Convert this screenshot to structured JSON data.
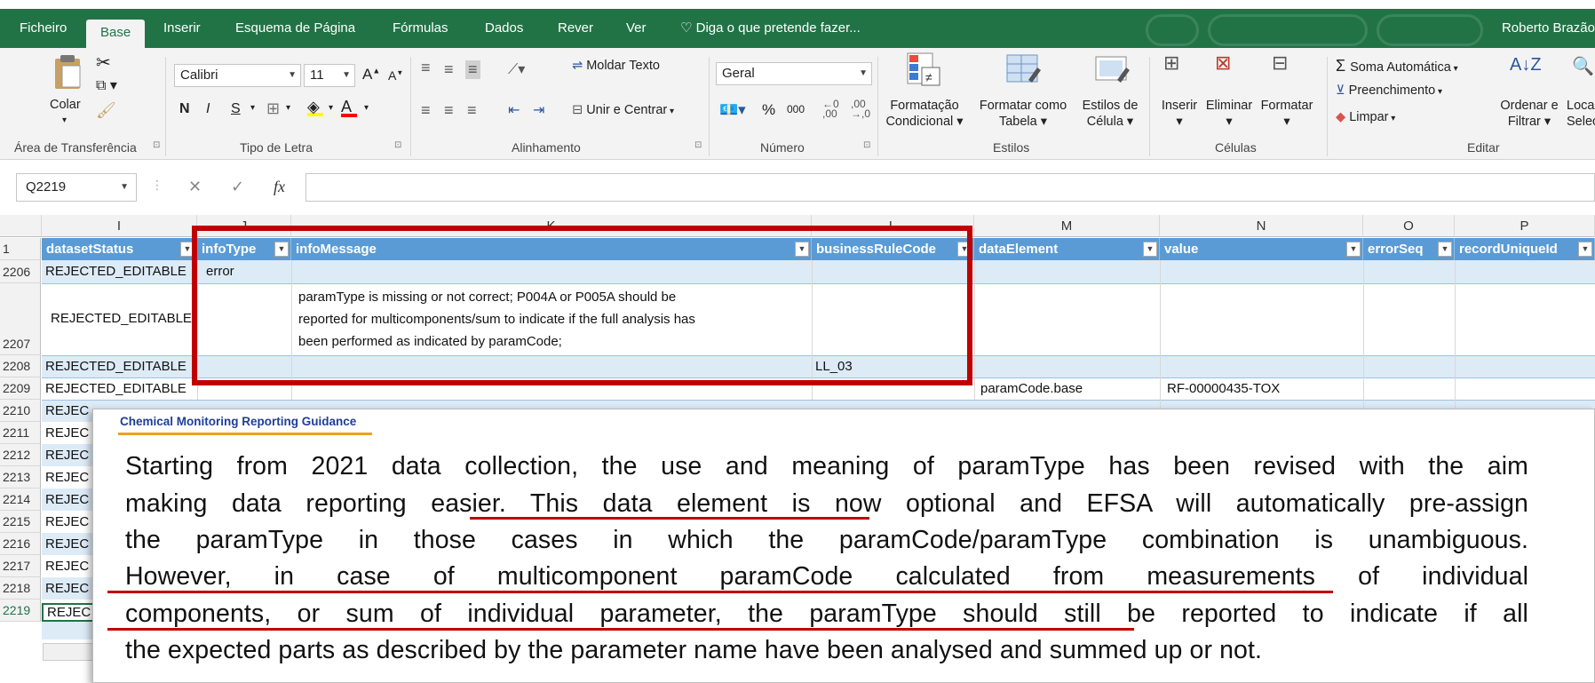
{
  "ribbon": {
    "tabs": [
      "Ficheiro",
      "Base",
      "Inserir",
      "Esquema de Página",
      "Fórmulas",
      "Dados",
      "Rever",
      "Ver"
    ],
    "tell_me": "Diga o que pretende fazer...",
    "user": "Roberto Brazão",
    "clipboard": {
      "paste": "Colar",
      "label": "Área de Transferência"
    },
    "font": {
      "name": "Calibri",
      "size": "11",
      "bold": "N",
      "italic": "I",
      "underline": "S",
      "label": "Tipo de Letra"
    },
    "alignment": {
      "wrap": "Moldar Texto",
      "merge": "Unir e Centrar",
      "label": "Alinhamento"
    },
    "number": {
      "format": "Geral",
      "percent": "%",
      "thousands": "000",
      "label": "Número"
    },
    "styles": {
      "conditional_1": "Formatação",
      "conditional_2": "Condicional",
      "table_1": "Formatar como",
      "table_2": "Tabela",
      "cell_1": "Estilos de",
      "cell_2": "Célula",
      "label": "Estilos"
    },
    "cells": {
      "insert": "Inserir",
      "delete": "Eliminar",
      "format": "Formatar",
      "label": "Células"
    },
    "editing": {
      "autosum": "Soma Automática",
      "fill": "Preenchimento",
      "clear": "Limpar",
      "sort_1": "Ordenar e",
      "sort_2": "Filtrar",
      "find_1": "Loca",
      "find_2": "Selec",
      "label": "Editar"
    }
  },
  "formula_bar": {
    "name_box": "Q2219",
    "fx": "fx",
    "value": ""
  },
  "grid": {
    "columns": [
      "I",
      "J",
      "K",
      "L",
      "M",
      "N",
      "O",
      "P"
    ],
    "headers": [
      "datasetStatus",
      "infoType",
      "infoMessage",
      "businessRuleCode",
      "dataElement",
      "value",
      "errorSeq",
      "recordUniqueId"
    ],
    "header_row": "1",
    "rows": [
      {
        "n": "2206",
        "status": "REJECTED_EDITABLE",
        "infoType": "error"
      },
      {
        "n": "2207",
        "status": "REJECTED_EDITABLE",
        "message": [
          "paramType is missing or not correct; P004A or P005A should be",
          "reported for multicomponents/sum to indicate if the full analysis has",
          "been performed as indicated by paramCode;"
        ]
      },
      {
        "n": "2208",
        "status": "REJECTED_EDITABLE",
        "rule": "LL_03"
      },
      {
        "n": "2209",
        "status": "REJECTED_EDITABLE",
        "element": "paramCode.base",
        "value": "RF-00000435-TOX"
      },
      {
        "n": "2210",
        "status": "REJEC"
      },
      {
        "n": "2211",
        "status": "REJEC"
      },
      {
        "n": "2212",
        "status": "REJEC"
      },
      {
        "n": "2213",
        "status": "REJEC"
      },
      {
        "n": "2214",
        "status": "REJEC"
      },
      {
        "n": "2215",
        "status": "REJEC"
      },
      {
        "n": "2216",
        "status": "REJEC"
      },
      {
        "n": "2217",
        "status": "REJEC"
      },
      {
        "n": "2218",
        "status": "REJEC"
      },
      {
        "n": "2219",
        "status": "REJEC"
      }
    ]
  },
  "overlay": {
    "title": "Chemical Monitoring Reporting Guidance",
    "lines": [
      "Starting from 2021 data collection, the use and meaning of paramType has been revised with the aim",
      "making data reporting easier. This data element is now optional and EFSA will automatically pre-assign",
      "the paramType in those cases in which the paramCode/paramType combination is unambiguous.",
      "However, in case of multicomponent paramCode calculated from measurements of individual",
      "components, or sum of individual parameter, the paramType should still be reported to indicate if all",
      "the expected parts as described by the parameter name have been analysed and summed up or not."
    ]
  },
  "colors": {
    "excel_green": "#217346",
    "table_header": "#5b9bd5",
    "band": "#ddebf7",
    "highlight": "#c00000",
    "title_rule": "#f0a020"
  }
}
